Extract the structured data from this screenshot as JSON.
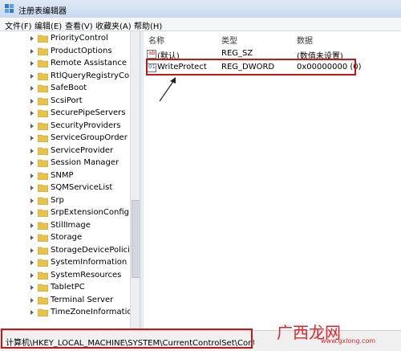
{
  "window": {
    "title": "注册表编辑器"
  },
  "menu": [
    "文件(F)",
    "编辑(E)",
    "查看(V)",
    "收藏夹(A)",
    "帮助(H)"
  ],
  "tree": [
    "PriorityControl",
    "ProductOptions",
    "Remote Assistance",
    "RtlQueryRegistryConf",
    "SafeBoot",
    "ScsiPort",
    "SecurePipeServers",
    "SecurityProviders",
    "ServiceGroupOrder",
    "ServiceProvider",
    "Session Manager",
    "SNMP",
    "SQMServiceList",
    "Srp",
    "SrpExtensionConfig",
    "StillImage",
    "Storage",
    "StorageDevicePolicies",
    "SystemInformation",
    "SystemResources",
    "TabletPC",
    "Terminal Server",
    "TimeZoneInformation"
  ],
  "columns": {
    "name": "名称",
    "type": "类型",
    "data": "数据"
  },
  "values": [
    {
      "name": "(默认)",
      "type": "REG_SZ",
      "data": "(数值未设置)"
    },
    {
      "name": "WriteProtect",
      "type": "REG_DWORD",
      "data": "0x00000000 (0)"
    }
  ],
  "status": {
    "path": "计算机\\HKEY_LOCAL_MACHINE\\SYSTEM\\CurrentControlSet\\Control\\StorageDevicePolicies"
  },
  "watermark": {
    "main": "广西龙网",
    "sub": "www.gxlong.com"
  }
}
